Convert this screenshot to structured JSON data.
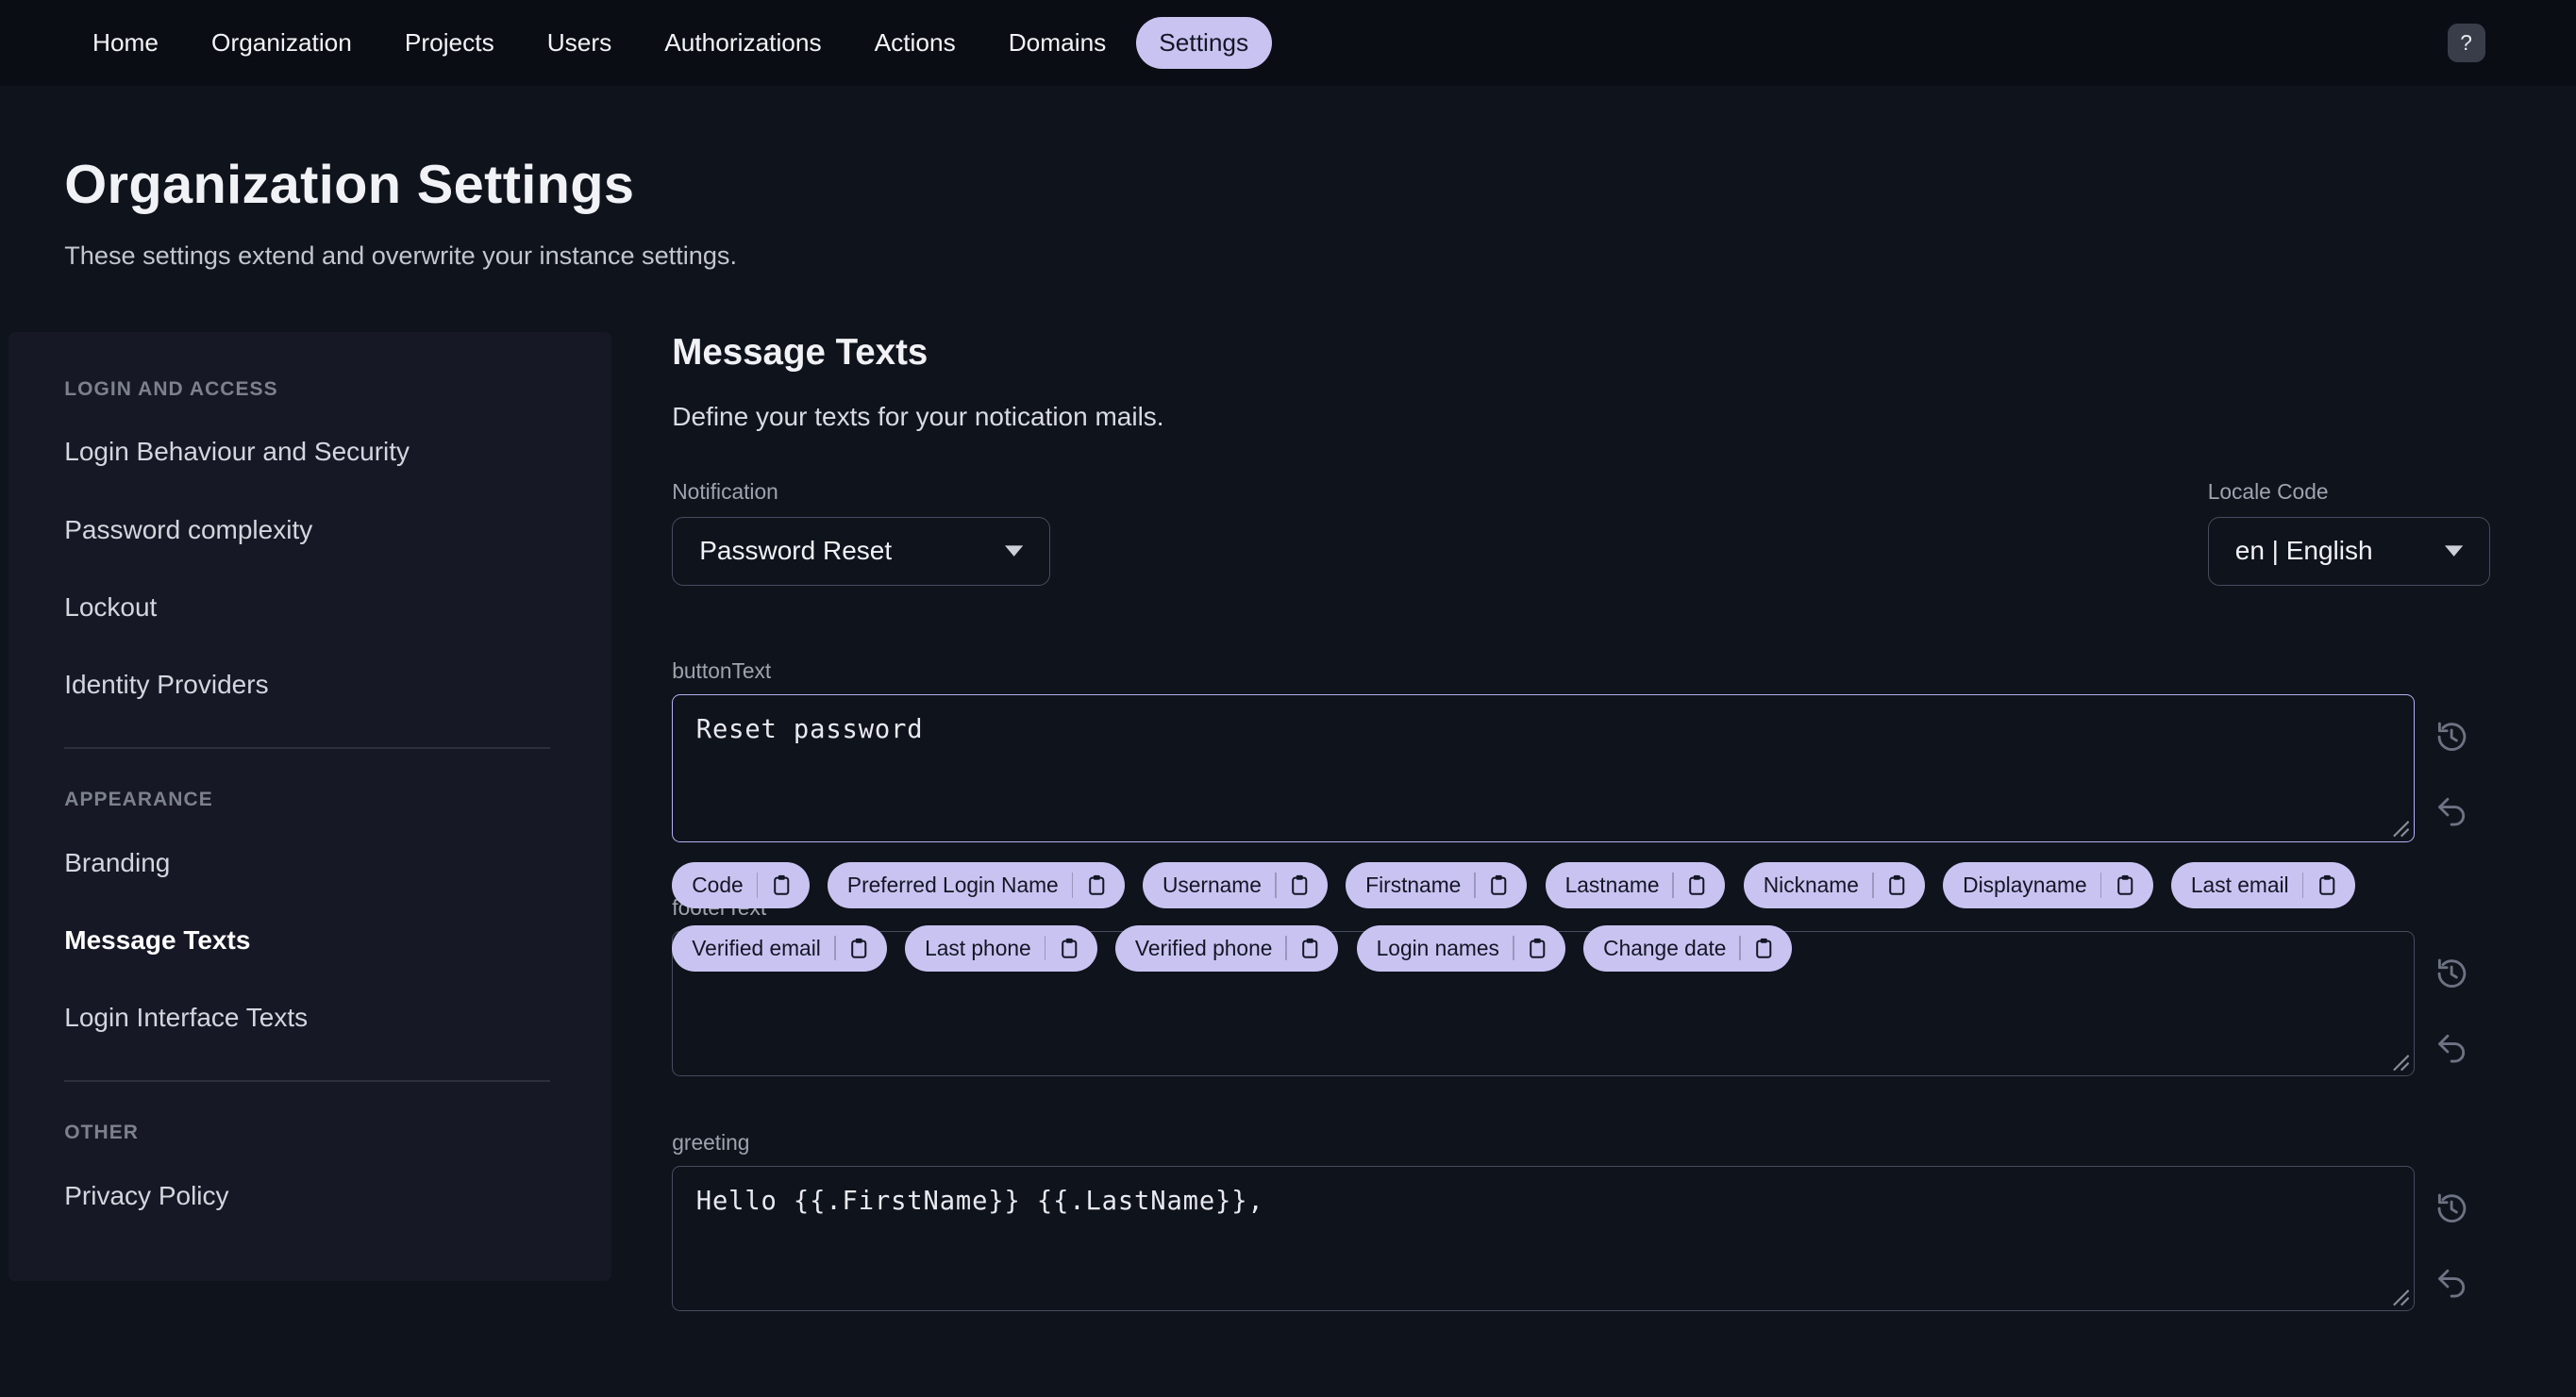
{
  "colors": {
    "nav_bg": "#0a0d13",
    "page_bg": "#0f131c",
    "sidebar_bg": "#161925",
    "text": "#f1f2f6",
    "muted": "#c3c6cf",
    "label": "#9fa3ae",
    "section_header": "#7d818d",
    "border": "#474c5c",
    "focus_border": "#b6aff2",
    "accent": "#c9c3f2",
    "accent_text": "#131624",
    "icon": "#6e7383",
    "divider": "#2c303c"
  },
  "nav": {
    "items": [
      "Home",
      "Organization",
      "Projects",
      "Users",
      "Authorizations",
      "Actions",
      "Domains",
      "Settings"
    ],
    "active": "Settings",
    "help_label": "?"
  },
  "page": {
    "title": "Organization Settings",
    "subtitle": "These settings extend and overwrite your instance settings."
  },
  "sidebar": {
    "sections": [
      {
        "header": "LOGIN AND ACCESS",
        "items": [
          "Login Behaviour and Security",
          "Password complexity",
          "Lockout",
          "Identity Providers"
        ]
      },
      {
        "header": "APPEARANCE",
        "items": [
          "Branding",
          "Message Texts",
          "Login Interface Texts"
        ]
      },
      {
        "header": "OTHER",
        "items": [
          "Privacy Policy"
        ]
      }
    ],
    "active_item": "Message Texts"
  },
  "main": {
    "title": "Message Texts",
    "subtitle": "Define your texts for your notication mails.",
    "notification": {
      "label": "Notification",
      "value": "Password Reset"
    },
    "locale": {
      "label": "Locale Code",
      "value": "en | English"
    },
    "fields": [
      {
        "label": "buttonText",
        "value": "Reset password"
      },
      {
        "label": "footerText",
        "value": ""
      },
      {
        "label": "greeting",
        "value": "Hello {{.FirstName}} {{.LastName}},"
      }
    ],
    "chips": [
      "Code",
      "Preferred Login Name",
      "Username",
      "Firstname",
      "Lastname",
      "Nickname",
      "Displayname",
      "Last email",
      "Verified email",
      "Last phone",
      "Verified phone",
      "Login names",
      "Change date"
    ]
  }
}
